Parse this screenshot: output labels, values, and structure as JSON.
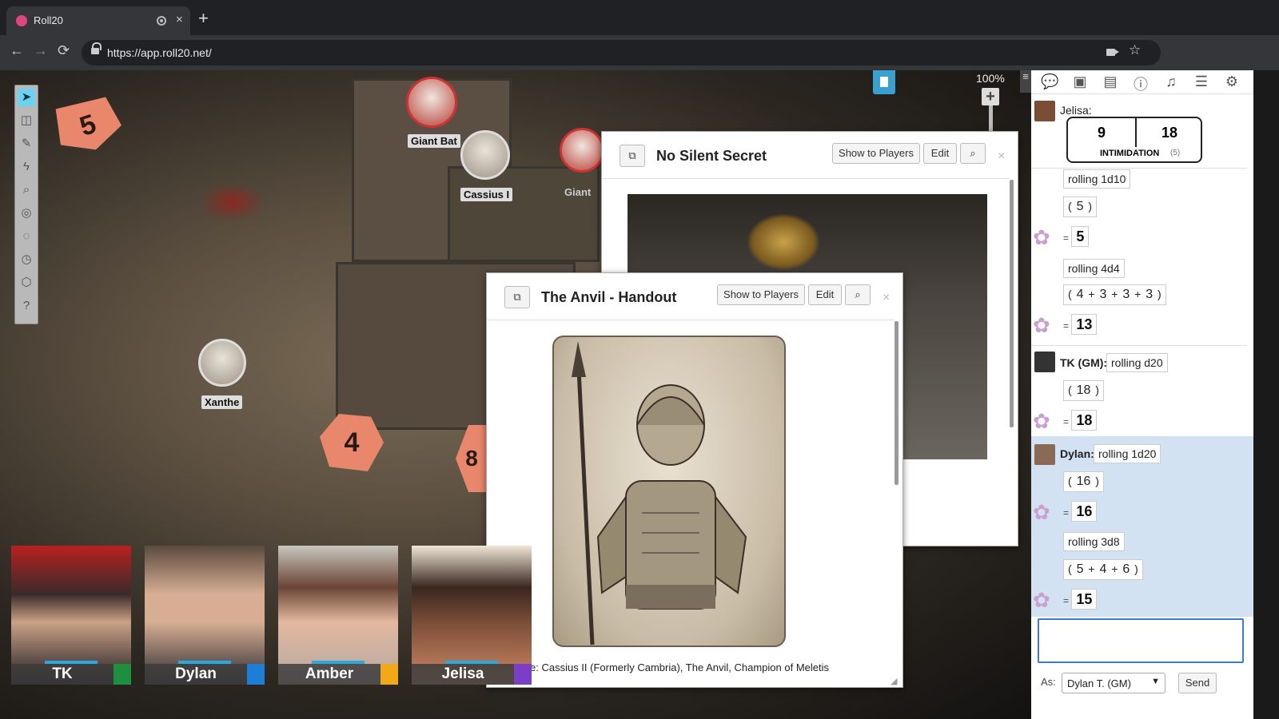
{
  "browser": {
    "tab_title": "Roll20",
    "tab_close": "×",
    "new_tab": "+",
    "url": "https://app.roll20.net/",
    "back": "←",
    "forward": "→",
    "reload": "⟳",
    "star": "☆"
  },
  "canvas": {
    "zoom": "100%",
    "zoom_plus": "+",
    "sidebar_toggle": "≡",
    "tokens": [
      {
        "name": "Giant Bat"
      },
      {
        "name": "Cassius I"
      },
      {
        "name": "Giant"
      },
      {
        "name": "Xanthe"
      }
    ],
    "dice": [
      {
        "value": "5"
      },
      {
        "value": "4"
      },
      {
        "value": "8"
      }
    ],
    "tools": [
      "select-tool",
      "map-tool",
      "draw-tool",
      "fx-tool",
      "zoom-tool",
      "measure-tool",
      "fog-tool",
      "turn-tracker-tool",
      "dice-tool",
      "help-tool"
    ]
  },
  "handout_secret": {
    "title": "No Silent Secret",
    "show_label": "Show to Players",
    "edit_label": "Edit",
    "close": "×"
  },
  "handout_anvil": {
    "title": "The Anvil - Handout",
    "show_label": "Show to Players",
    "edit_label": "Edit",
    "close": "×",
    "caption": "e: Cassius II (Formerly Cambria), The Anvil, Champion of Meletis"
  },
  "players": [
    {
      "name": "TK",
      "color": "#1e8f3c"
    },
    {
      "name": "Dylan",
      "color": "#1b7fd8"
    },
    {
      "name": "Amber",
      "color": "#f2a818"
    },
    {
      "name": "Jelisa",
      "color": "#7b3fc7"
    }
  ],
  "chat": {
    "messages": {
      "jelisa_who": "Jelisa:",
      "intim_a": "9",
      "intim_b": "18",
      "intim_label": "INTIMIDATION",
      "intim_mod": "(5)",
      "r1_label": "rolling 1d10",
      "r1_die": "5",
      "r1_total": "5",
      "r2_label": "rolling 4d4",
      "r2_d1": "4",
      "r2_d2": "3",
      "r2_d3": "3",
      "r2_d4": "3",
      "r2_total": "13",
      "tk_who": "TK (GM):",
      "r3_label": "rolling d20",
      "r3_die": "18",
      "r3_total": "18",
      "dylan_who": "Dylan:",
      "r4_label": "rolling 1d20",
      "r4_die": "16",
      "r4_total": "16",
      "r5_label": "rolling 3d8",
      "r5_d1": "5",
      "r5_d2": "4",
      "r5_d3": "6",
      "r5_total": "15"
    },
    "input_value": "",
    "as_label": "As:",
    "as_value": "Dylan T. (GM)",
    "send_label": "Send"
  },
  "colors": {
    "accent": "#6bd2f5",
    "die": "#e8876b",
    "dylan_highlight": "#d2e2f2"
  }
}
